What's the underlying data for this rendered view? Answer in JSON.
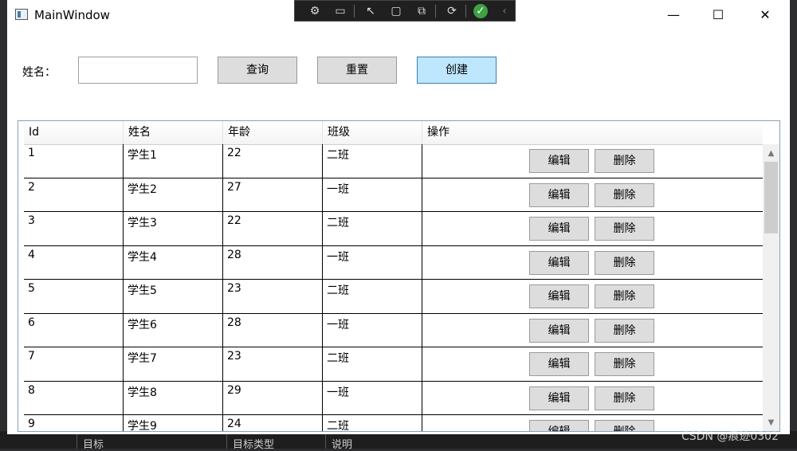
{
  "window": {
    "title": "MainWindow",
    "minimize": "—",
    "maximize": "☐",
    "close": "✕"
  },
  "form": {
    "name_label": "姓名：",
    "name_value": "",
    "query_label": "查询",
    "reset_label": "重置",
    "create_label": "创建"
  },
  "grid": {
    "columns": [
      "Id",
      "姓名",
      "年龄",
      "班级",
      "操作"
    ],
    "edit_label": "编辑",
    "delete_label": "删除",
    "rows": [
      {
        "id": "1",
        "name": "学生1",
        "age": "22",
        "cls": "二班"
      },
      {
        "id": "2",
        "name": "学生2",
        "age": "27",
        "cls": "一班"
      },
      {
        "id": "3",
        "name": "学生3",
        "age": "22",
        "cls": "二班"
      },
      {
        "id": "4",
        "name": "学生4",
        "age": "28",
        "cls": "一班"
      },
      {
        "id": "5",
        "name": "学生5",
        "age": "23",
        "cls": "二班"
      },
      {
        "id": "6",
        "name": "学生6",
        "age": "28",
        "cls": "一班"
      },
      {
        "id": "7",
        "name": "学生7",
        "age": "23",
        "cls": "二班"
      },
      {
        "id": "8",
        "name": "学生8",
        "age": "29",
        "cls": "一班"
      },
      {
        "id": "9",
        "name": "学生9",
        "age": "24",
        "cls": "二班"
      }
    ]
  },
  "background_strip": {
    "items": [
      "目标",
      "目标类型",
      "说明"
    ]
  },
  "watermark": "CSDN @痕迹0302",
  "colors": {
    "create_button_bg": "#bee6fd",
    "button_bg": "#dddddd"
  }
}
